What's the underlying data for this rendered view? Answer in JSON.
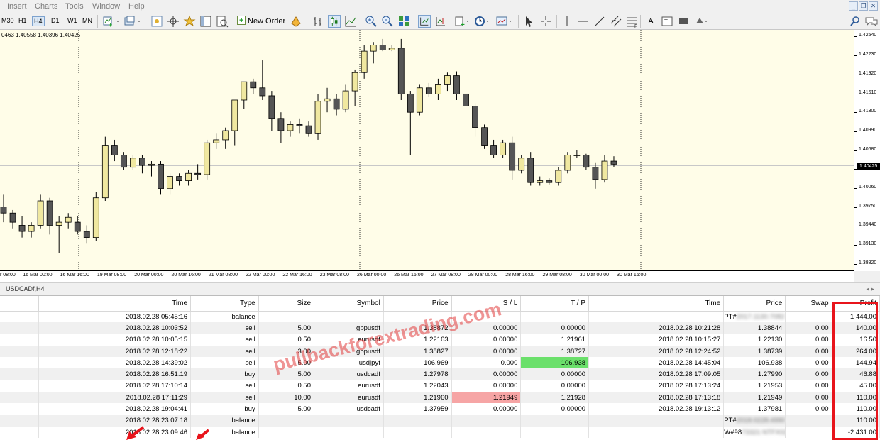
{
  "menu": [
    "Insert",
    "Charts",
    "Tools",
    "Window",
    "Help"
  ],
  "window_controls": [
    "_",
    "❐",
    "✕"
  ],
  "toolbar": {
    "timeframes": [
      {
        "label": "M30",
        "active": false
      },
      {
        "label": "H1",
        "active": false
      },
      {
        "label": "H4",
        "active": true
      },
      {
        "label": "D1",
        "active": false
      },
      {
        "label": "W1",
        "active": false
      },
      {
        "label": "MN",
        "active": false
      }
    ],
    "new_order_label": "New Order",
    "text_tool": "A"
  },
  "chart": {
    "ohlc_text": "0463 1.40558 1.40396 1.40425",
    "current_price": "1.40425",
    "price_labels": [
      "1.42540",
      "1.42230",
      "1.41920",
      "1.41610",
      "1.41300",
      "1.40990",
      "1.40680",
      "1.40370",
      "1.40060",
      "1.39750",
      "1.39440",
      "1.39130",
      "1.38820"
    ],
    "time_labels": [
      "r 08:00",
      "16 Mar 00:00",
      "16 Mar 16:00",
      "19 Mar 08:00",
      "20 Mar 00:00",
      "20 Mar 16:00",
      "21 Mar 08:00",
      "22 Mar 00:00",
      "22 Mar 16:00",
      "23 Mar 08:00",
      "26 Mar 00:00",
      "26 Mar 16:00",
      "27 Mar 08:00",
      "28 Mar 00:00",
      "28 Mar 16:00",
      "29 Mar 08:00",
      "30 Mar 00:00",
      "30 Mar 16:00"
    ],
    "tab_label": "USDCADf,H4",
    "colors": {
      "background": "#fffde8",
      "bull": "#f0e8a0",
      "bear": "#555555",
      "line": "#000000"
    }
  },
  "chart_data": {
    "type": "candlestick",
    "symbol": "USDCADf",
    "timeframe": "H4",
    "ylim": [
      1.387,
      1.4265
    ],
    "candles": [
      [
        1.3975,
        1.3995,
        1.395,
        1.3965
      ],
      [
        1.3965,
        1.397,
        1.394,
        1.395
      ],
      [
        1.3945,
        1.396,
        1.3925,
        1.3935
      ],
      [
        1.3935,
        1.395,
        1.3925,
        1.3945
      ],
      [
        1.3945,
        1.3995,
        1.394,
        1.3985
      ],
      [
        1.3985,
        1.399,
        1.393,
        1.3945
      ],
      [
        1.3945,
        1.396,
        1.39,
        1.395
      ],
      [
        1.395,
        1.3965,
        1.394,
        1.3958
      ],
      [
        1.395,
        1.396,
        1.393,
        1.3935
      ],
      [
        1.3935,
        1.3945,
        1.3915,
        1.3925
      ],
      [
        1.3925,
        1.4,
        1.392,
        1.399
      ],
      [
        1.399,
        1.409,
        1.3985,
        1.4075
      ],
      [
        1.4075,
        1.4085,
        1.405,
        1.406
      ],
      [
        1.406,
        1.4065,
        1.4035,
        1.404
      ],
      [
        1.404,
        1.406,
        1.4035,
        1.4055
      ],
      [
        1.4055,
        1.406,
        1.403,
        1.4043
      ],
      [
        1.4043,
        1.405,
        1.4025,
        1.4045
      ],
      [
        1.4045,
        1.405,
        1.3995,
        1.4005
      ],
      [
        1.4005,
        1.403,
        1.3995,
        1.4025
      ],
      [
        1.4025,
        1.403,
        1.401,
        1.4018
      ],
      [
        1.4018,
        1.4035,
        1.401,
        1.403
      ],
      [
        1.403,
        1.4045,
        1.402,
        1.4028
      ],
      [
        1.4028,
        1.4085,
        1.402,
        1.408
      ],
      [
        1.408,
        1.4095,
        1.407,
        1.4085
      ],
      [
        1.4085,
        1.4105,
        1.407,
        1.41
      ],
      [
        1.41,
        1.414,
        1.4075,
        1.415
      ],
      [
        1.415,
        1.418,
        1.4135,
        1.418
      ],
      [
        1.418,
        1.4185,
        1.416,
        1.417
      ],
      [
        1.417,
        1.4215,
        1.415,
        1.4157
      ],
      [
        1.4157,
        1.4165,
        1.41,
        1.412
      ],
      [
        1.412,
        1.413,
        1.408,
        1.41
      ],
      [
        1.41,
        1.4115,
        1.409,
        1.411
      ],
      [
        1.411,
        1.412,
        1.4095,
        1.4108
      ],
      [
        1.4108,
        1.4115,
        1.409,
        1.4095
      ],
      [
        1.4095,
        1.416,
        1.4085,
        1.4148
      ],
      [
        1.4148,
        1.417,
        1.413,
        1.4152
      ],
      [
        1.4152,
        1.416,
        1.4125,
        1.4135
      ],
      [
        1.4135,
        1.4175,
        1.413,
        1.4165
      ],
      [
        1.4165,
        1.42,
        1.414,
        1.4195
      ],
      [
        1.4195,
        1.424,
        1.4185,
        1.423
      ],
      [
        1.423,
        1.4245,
        1.421,
        1.424
      ],
      [
        1.424,
        1.425,
        1.423,
        1.4232
      ],
      [
        1.4232,
        1.424,
        1.423,
        1.4235
      ],
      [
        1.4235,
        1.425,
        1.415,
        1.416
      ],
      [
        1.416,
        1.4165,
        1.406,
        1.413
      ],
      [
        1.413,
        1.4175,
        1.4125,
        1.417
      ],
      [
        1.417,
        1.4178,
        1.4155,
        1.416
      ],
      [
        1.416,
        1.4185,
        1.415,
        1.4175
      ],
      [
        1.4175,
        1.4195,
        1.4165,
        1.419
      ],
      [
        1.419,
        1.4197,
        1.415,
        1.416
      ],
      [
        1.416,
        1.418,
        1.413,
        1.414
      ],
      [
        1.414,
        1.4145,
        1.409,
        1.4105
      ],
      [
        1.4105,
        1.411,
        1.407,
        1.4075
      ],
      [
        1.4075,
        1.4085,
        1.4055,
        1.406
      ],
      [
        1.406,
        1.4085,
        1.4055,
        1.408
      ],
      [
        1.408,
        1.409,
        1.402,
        1.4035
      ],
      [
        1.4035,
        1.406,
        1.403,
        1.4055
      ],
      [
        1.4055,
        1.4065,
        1.401,
        1.4015
      ],
      [
        1.4015,
        1.4025,
        1.401,
        1.4018
      ],
      [
        1.4018,
        1.4022,
        1.4012,
        1.4015
      ],
      [
        1.4015,
        1.404,
        1.401,
        1.4035
      ],
      [
        1.4035,
        1.4065,
        1.403,
        1.406
      ],
      [
        1.406,
        1.4068,
        1.4055,
        1.406
      ],
      [
        1.406,
        1.4062,
        1.4035,
        1.404
      ],
      [
        1.404,
        1.4048,
        1.4005,
        1.402
      ],
      [
        1.402,
        1.406,
        1.4015,
        1.405
      ],
      [
        1.405,
        1.4058,
        1.404,
        1.4045
      ]
    ]
  },
  "table": {
    "headers": [
      "Time",
      "Type",
      "Size",
      "Symbol",
      "Price",
      "S / L",
      "T / P",
      "Time",
      "Price",
      "Swap",
      "Profit"
    ],
    "rows": [
      [
        "2018.02.28 05:45:16",
        "balance",
        "",
        "",
        "",
        "",
        "",
        "",
        "PT#2017.1130.7082",
        "",
        "1 444.00"
      ],
      [
        "2018.02.28 10:03:52",
        "sell",
        "5.00",
        "gbpusdf",
        "1.38872",
        "0.00000",
        "0.00000",
        "2018.02.28 10:21:28",
        "1.38844",
        "0.00",
        "140.00"
      ],
      [
        "2018.02.28 10:05:15",
        "sell",
        "0.50",
        "eurusdf",
        "1.22163",
        "0.00000",
        "1.21961",
        "2018.02.28 10:15:27",
        "1.22130",
        "0.00",
        "16.50"
      ],
      [
        "2018.02.28 12:18:22",
        "sell",
        "3.00",
        "gbpusdf",
        "1.38827",
        "0.00000",
        "1.38727",
        "2018.02.28 12:24:52",
        "1.38739",
        "0.00",
        "264.00"
      ],
      [
        "2018.02.28 14:39:02",
        "sell",
        "5.00",
        "usdjpyf",
        "106.969",
        "0.000",
        "106.938",
        "2018.02.28 14:45:04",
        "106.938",
        "0.00",
        "144.94"
      ],
      [
        "2018.02.28 16:51:19",
        "buy",
        "5.00",
        "usdcadf",
        "1.27978",
        "0.00000",
        "0.00000",
        "2018.02.28 17:09:05",
        "1.27990",
        "0.00",
        "46.88"
      ],
      [
        "2018.02.28 17:10:14",
        "sell",
        "0.50",
        "eurusdf",
        "1.22043",
        "0.00000",
        "0.00000",
        "2018.02.28 17:13:24",
        "1.21953",
        "0.00",
        "45.00"
      ],
      [
        "2018.02.28 17:11:29",
        "sell",
        "10.00",
        "eurusdf",
        "1.21960",
        "1.21949",
        "1.21928",
        "2018.02.28 17:13:18",
        "1.21949",
        "0.00",
        "110.00"
      ],
      [
        "2018.02.28 19:04:41",
        "buy",
        "5.00",
        "usdcadf",
        "1.37959",
        "0.00000",
        "0.00000",
        "2018.02.28 19:13:12",
        "1.37981",
        "0.00",
        "110.00"
      ],
      [
        "2018.02.28 23:07:18",
        "balance",
        "",
        "",
        "",
        "",
        "",
        "",
        "PT#2018.0228.4990",
        "",
        "110.00"
      ],
      [
        "2018.02.28 23:09:46",
        "balance",
        "",
        "",
        "",
        "",
        "",
        "",
        "W#9873321 NTFX0228B",
        "",
        "-2 431.00"
      ]
    ],
    "highlight_red": [
      7,
      5
    ],
    "highlight_green": [
      4,
      6
    ]
  },
  "watermark": "pullbackforextrading.com"
}
